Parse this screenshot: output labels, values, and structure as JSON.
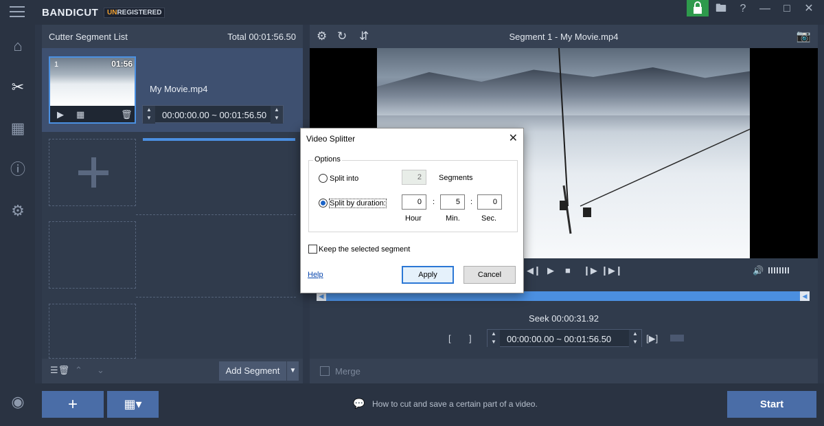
{
  "app": {
    "brand_main": "BANDI",
    "brand_cut": "CUT",
    "reg_un": "UN",
    "reg_rest": "REGISTERED"
  },
  "segment_list": {
    "title": "Cutter Segment List",
    "total": "Total 00:01:56.50",
    "segment": {
      "index": "1",
      "duration": "01:56",
      "filename": "My Movie.mp4",
      "time_range": "00:00:00.00 ~ 00:01:56.50"
    },
    "add_segment_label": "Add Segment"
  },
  "preview": {
    "title": "Segment 1 - My Movie.mp4",
    "seek": "Seek 00:00:31.92",
    "range": "00:00:00.00  ~  00:01:56.50",
    "merge_label": "Merge"
  },
  "bottom": {
    "tip": "How to cut and save a certain part of a video.",
    "start_label": "Start"
  },
  "dialog": {
    "title": "Video Splitter",
    "options_label": "Options",
    "split_into_label": "Split into",
    "split_into_value": "2",
    "segments_label": "Segments",
    "split_by_duration_label": "Split by duration:",
    "hour_value": "0",
    "min_value": "5",
    "sec_value": "0",
    "hour_label": "Hour",
    "min_label": "Min.",
    "sec_label": "Sec.",
    "colon": ":",
    "keep_label": "Keep the selected segment",
    "help_label": "Help",
    "apply_label": "Apply",
    "cancel_label": "Cancel"
  }
}
